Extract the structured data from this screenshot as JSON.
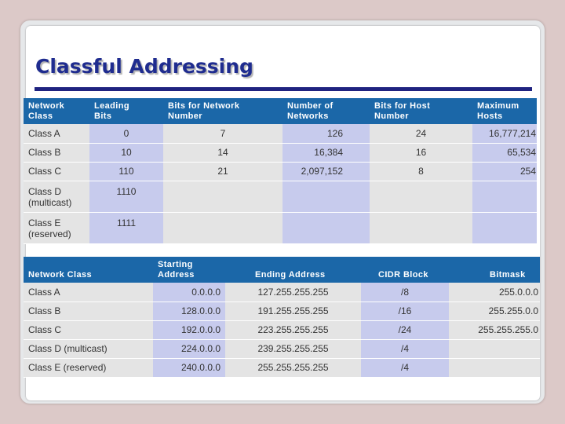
{
  "title": "Classful Addressing",
  "table1": {
    "headers": [
      "NETWORK CLASS",
      "LEADING BITS",
      "BITS FOR NETWORK NUMBER",
      "NUMBER OF NETWORKS",
      "BITS FOR HOST NUMBER",
      "MAXIMUM HOSTS"
    ],
    "header_lines": [
      [
        "Network",
        "Class"
      ],
      [
        "Leading",
        "Bits"
      ],
      [
        "Bits for Network",
        "Number"
      ],
      [
        "Number of",
        "Networks"
      ],
      [
        "Bits for Host",
        "Number"
      ],
      [
        "Maximum",
        "Hosts"
      ]
    ],
    "rows": [
      {
        "cls": "Class A",
        "cls2": "",
        "lead": "0",
        "netbits": "7",
        "nets": "126",
        "hostbits": "24",
        "hosts": "16,777,214"
      },
      {
        "cls": "Class B",
        "cls2": "",
        "lead": "10",
        "netbits": "14",
        "nets": "16,384",
        "hostbits": "16",
        "hosts": "65,534"
      },
      {
        "cls": "Class C",
        "cls2": "",
        "lead": "110",
        "netbits": "21",
        "nets": "2,097,152",
        "hostbits": "8",
        "hosts": "254"
      },
      {
        "cls": "Class D",
        "cls2": "(multicast)",
        "lead": "1110",
        "netbits": "",
        "nets": "",
        "hostbits": "",
        "hosts": ""
      },
      {
        "cls": "Class E",
        "cls2": "(reserved)",
        "lead": "1111",
        "netbits": "",
        "nets": "",
        "hostbits": "",
        "hosts": ""
      }
    ]
  },
  "table2": {
    "header_lines": [
      [
        "",
        "Network Class"
      ],
      [
        "Starting",
        "Address"
      ],
      [
        "",
        "Ending Address"
      ],
      [
        "",
        "CIDR Block"
      ],
      [
        "",
        "Bitmask"
      ]
    ],
    "rows": [
      {
        "cls": "Class A",
        "start": "0.0.0.0",
        "end": "127.255.255.255",
        "cidr": "/8",
        "mask": "255.0.0.0"
      },
      {
        "cls": "Class B",
        "start": "128.0.0.0",
        "end": "191.255.255.255",
        "cidr": "/16",
        "mask": "255.255.0.0"
      },
      {
        "cls": "Class C",
        "start": "192.0.0.0",
        "end": "223.255.255.255",
        "cidr": "/24",
        "mask": "255.255.255.0"
      },
      {
        "cls": "Class D (multicast)",
        "start": "224.0.0.0",
        "end": "239.255.255.255",
        "cidr": "/4",
        "mask": ""
      },
      {
        "cls": "Class E (reserved)",
        "start": "240.0.0.0",
        "end": "255.255.255.255",
        "cidr": "/4",
        "mask": ""
      }
    ]
  },
  "colors": {
    "title": "#1f2c8f",
    "rule": "#1f2380",
    "header_bg": "#1b67a8",
    "band_gray": "#e4e4e4",
    "band_lavender": "#c7cbed"
  }
}
